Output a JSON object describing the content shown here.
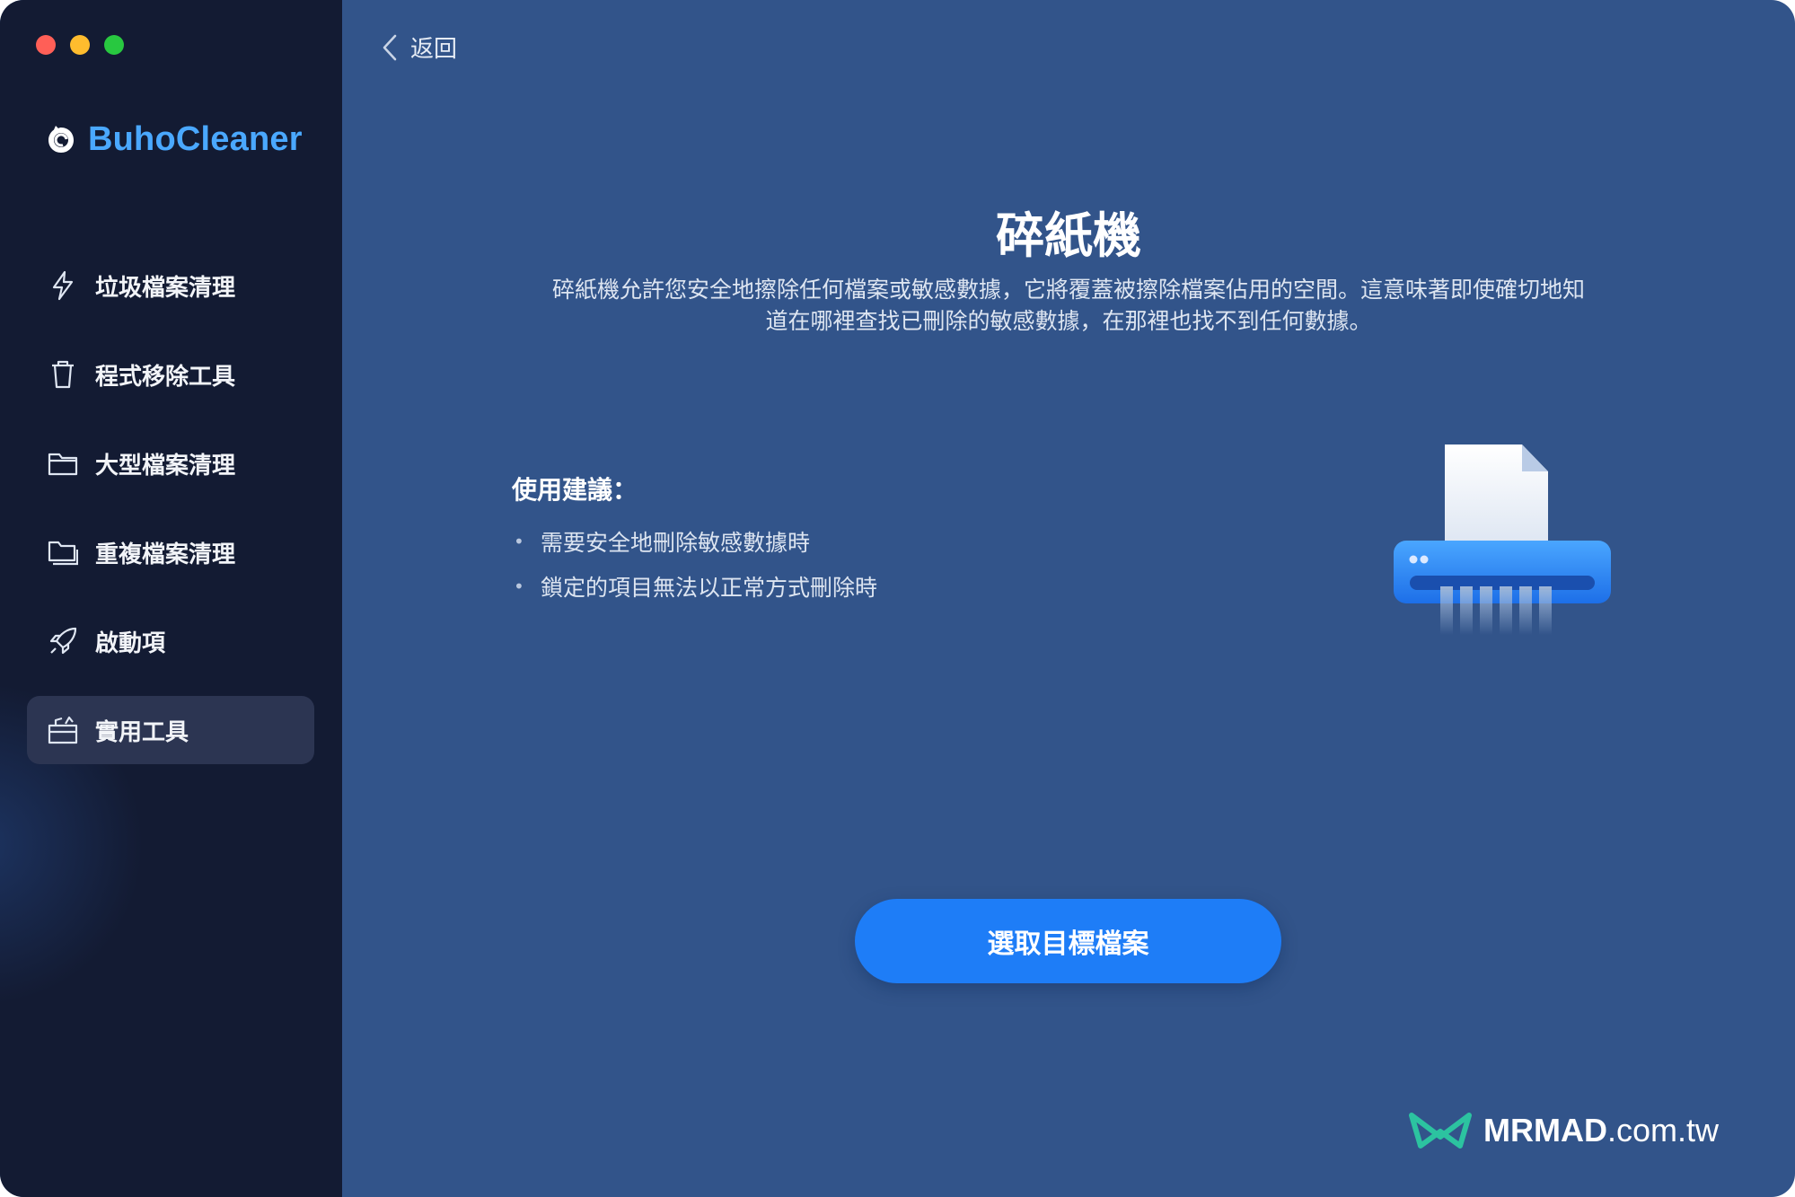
{
  "window": {
    "controls": {
      "close_color": "#ff5f57",
      "minimize_color": "#febc2e",
      "zoom_color": "#28c840"
    }
  },
  "sidebar": {
    "brand": "BuhoCleaner",
    "brand_color": "#4aa8ff",
    "items": [
      {
        "label": "垃圾檔案清理",
        "icon": "lightning-icon",
        "active": false
      },
      {
        "label": "程式移除工具",
        "icon": "trash-icon",
        "active": false
      },
      {
        "label": "大型檔案清理",
        "icon": "folder-icon",
        "active": false
      },
      {
        "label": "重複檔案清理",
        "icon": "duplicate-folder-icon",
        "active": false
      },
      {
        "label": "啟動項",
        "icon": "rocket-icon",
        "active": false
      },
      {
        "label": "實用工具",
        "icon": "toolbox-icon",
        "active": true
      }
    ]
  },
  "header": {
    "back_label": "返回",
    "back_icon": "chevron-left-icon"
  },
  "main": {
    "title": "碎紙機",
    "description_line1": "碎紙機允許您安全地擦除任何檔案或敏感數據，它將覆蓋被擦除檔案佔用的空間。這意味著即使確切地知",
    "description_line2": "道在哪裡查找已刪除的敏感數據，在那裡也找不到任何數據。",
    "tips_heading": "使用建議：",
    "tips": [
      "需要安全地刪除敏感數據時",
      "鎖定的項目無法以正常方式刪除時"
    ],
    "illustration_icon": "file-shredder-icon",
    "primary_button": "選取目標檔案",
    "accent_color": "#1e7df7"
  },
  "watermark": {
    "brand": "MRMAD",
    "suffix": ".com.tw"
  }
}
